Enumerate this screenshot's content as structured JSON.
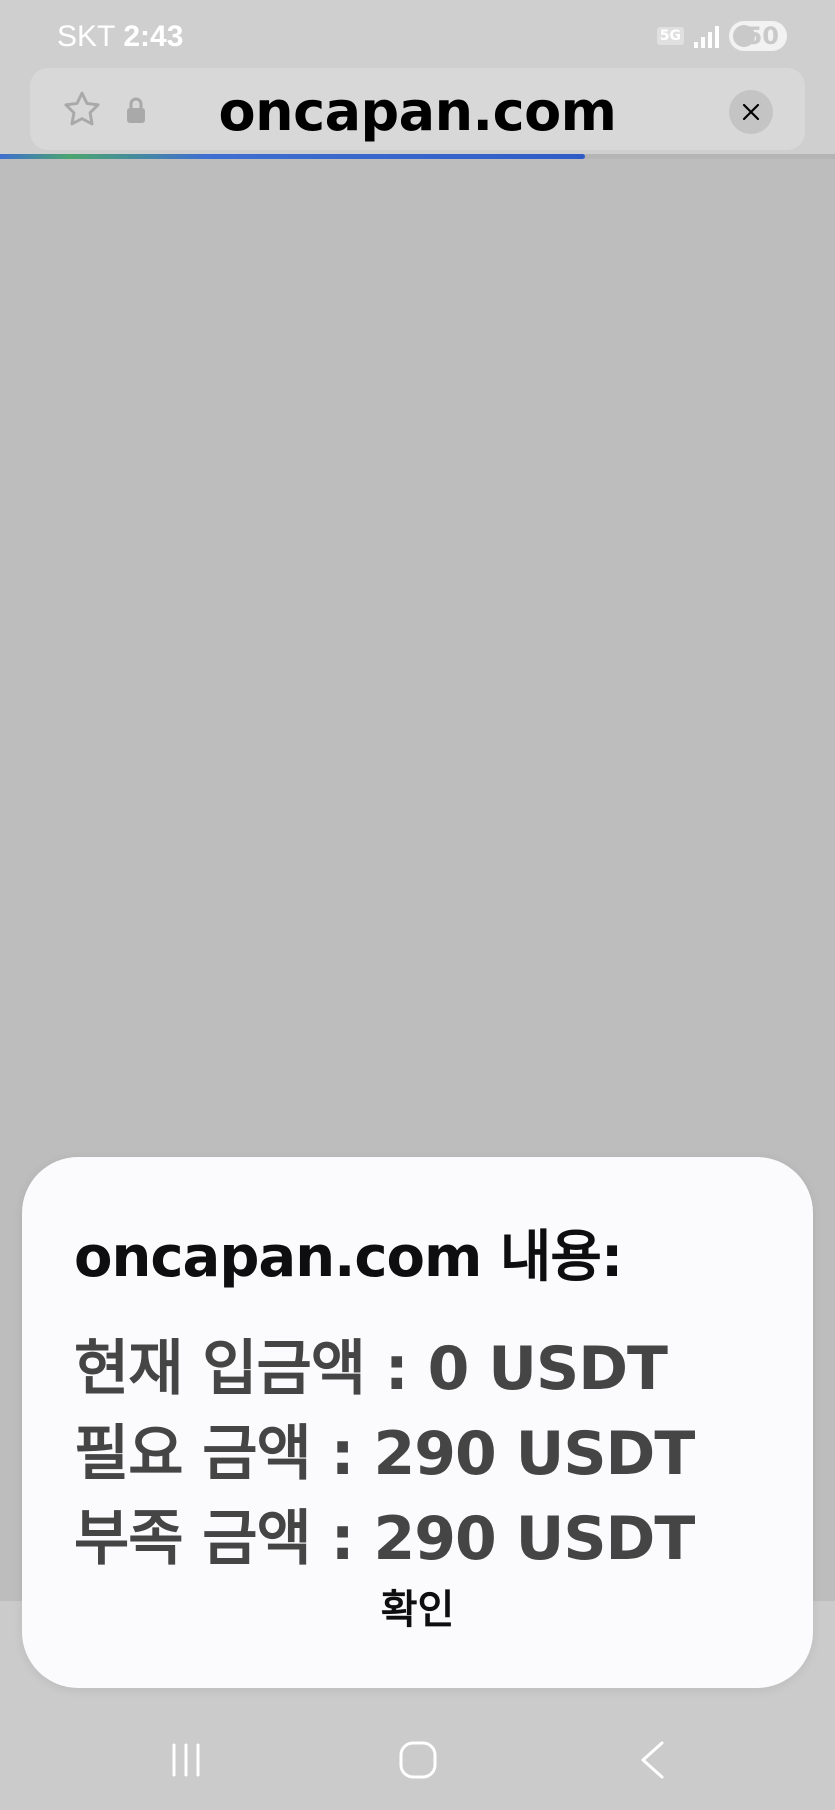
{
  "status_bar": {
    "carrier": "SKT",
    "time": "2:43",
    "network": "5G",
    "battery": "50"
  },
  "browser": {
    "url": "oncapan.com",
    "load_progress_percent": 70
  },
  "dialog": {
    "title": "oncapan.com 내용:",
    "lines": [
      "현재 입금액 : 0 USDT",
      "필요 금액 : 290 USDT",
      "부족 금액 : 290 USDT"
    ],
    "ok_label": "확인"
  },
  "icons": {
    "star": "star-icon",
    "lock": "lock-icon",
    "close": "close-icon",
    "recent": "recent-apps-icon",
    "home": "home-icon",
    "back": "back-icon"
  }
}
